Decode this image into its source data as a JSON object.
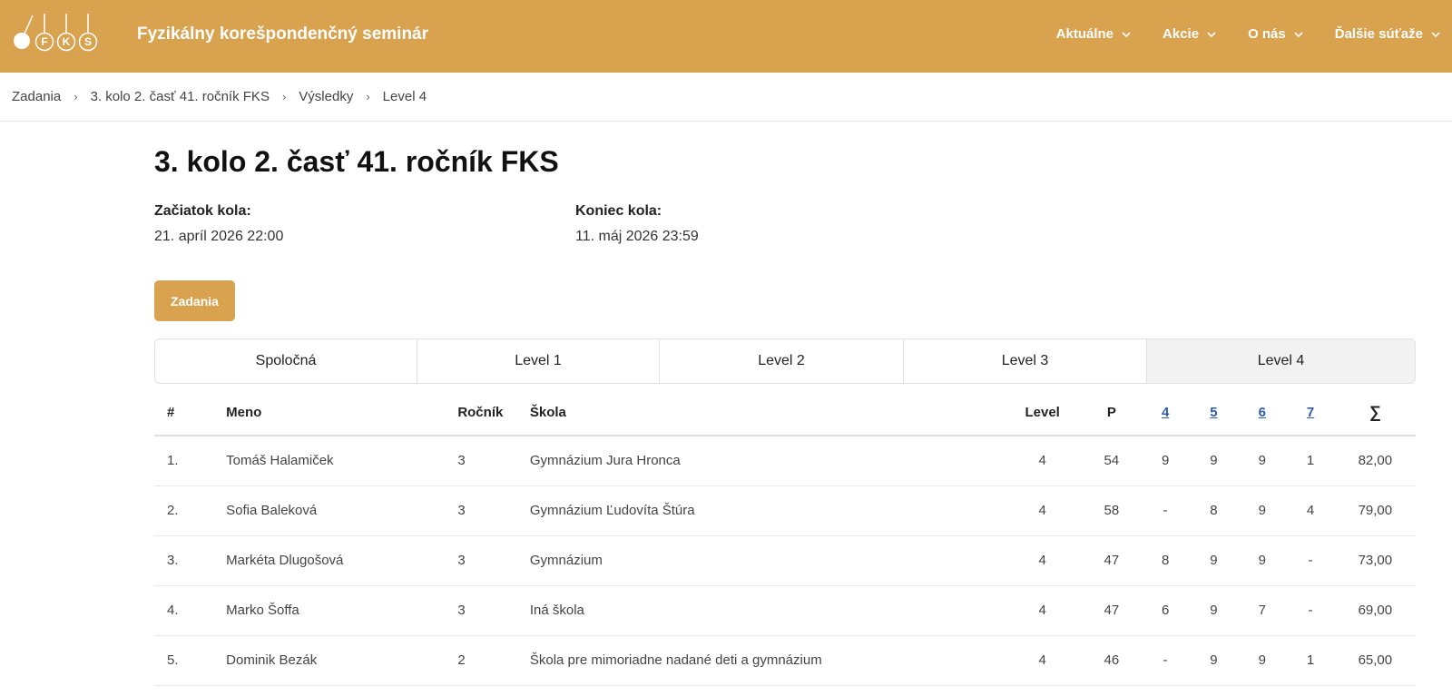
{
  "header": {
    "logo_text": "FKS",
    "brand": "Fyzikálny korešpondenčný seminár",
    "nav": [
      {
        "label": "Aktuálne"
      },
      {
        "label": "Akcie"
      },
      {
        "label": "O nás"
      },
      {
        "label": "Ďalšie súťaže"
      }
    ]
  },
  "breadcrumb": [
    "Zadania",
    "3. kolo 2. časť 41. ročník FKS",
    "Výsledky",
    "Level 4"
  ],
  "page": {
    "title": "3. kolo 2. časť 41. ročník FKS",
    "start_label": "Začiatok kola:",
    "start_value": "21. apríl 2026 22:00",
    "end_label": "Koniec kola:",
    "end_value": "11. máj 2026 23:59",
    "zadania_button": "Zadania"
  },
  "tabs": [
    {
      "label": "Spoločná",
      "active": false
    },
    {
      "label": "Level 1",
      "active": false
    },
    {
      "label": "Level 2",
      "active": false
    },
    {
      "label": "Level 3",
      "active": false
    },
    {
      "label": "Level 4",
      "active": true
    }
  ],
  "table": {
    "headers": {
      "num": "#",
      "name": "Meno",
      "rocnik": "Ročník",
      "skola": "Škola",
      "level": "Level",
      "p": "P",
      "t4": "4",
      "t5": "5",
      "t6": "6",
      "t7": "7",
      "sum": "∑"
    },
    "rows": [
      {
        "num": "1.",
        "name": "Tomáš Halamiček",
        "rocnik": "3",
        "skola": "Gymnázium Jura Hronca",
        "level": "4",
        "p": "54",
        "t4": "9",
        "t5": "9",
        "t6": "9",
        "t7": "1",
        "sum": "82,00"
      },
      {
        "num": "2.",
        "name": "Sofia Baleková",
        "rocnik": "3",
        "skola": "Gymnázium Ľudovíta Štúra",
        "level": "4",
        "p": "58",
        "t4": "-",
        "t5": "8",
        "t6": "9",
        "t7": "4",
        "sum": "79,00"
      },
      {
        "num": "3.",
        "name": "Markéta Dlugošová",
        "rocnik": "3",
        "skola": "Gymnázium",
        "level": "4",
        "p": "47",
        "t4": "8",
        "t5": "9",
        "t6": "9",
        "t7": "-",
        "sum": "73,00"
      },
      {
        "num": "4.",
        "name": "Marko Šoffa",
        "rocnik": "3",
        "skola": "Iná škola",
        "level": "4",
        "p": "47",
        "t4": "6",
        "t5": "9",
        "t6": "7",
        "t7": "-",
        "sum": "69,00"
      },
      {
        "num": "5.",
        "name": "Dominik Bezák",
        "rocnik": "2",
        "skola": "Škola pre mimoriadne nadané deti a gymnázium",
        "level": "4",
        "p": "46",
        "t4": "-",
        "t5": "9",
        "t6": "9",
        "t7": "1",
        "sum": "65,00"
      }
    ]
  },
  "colors": {
    "accent": "#d9a24f",
    "link": "#2a5db0"
  }
}
